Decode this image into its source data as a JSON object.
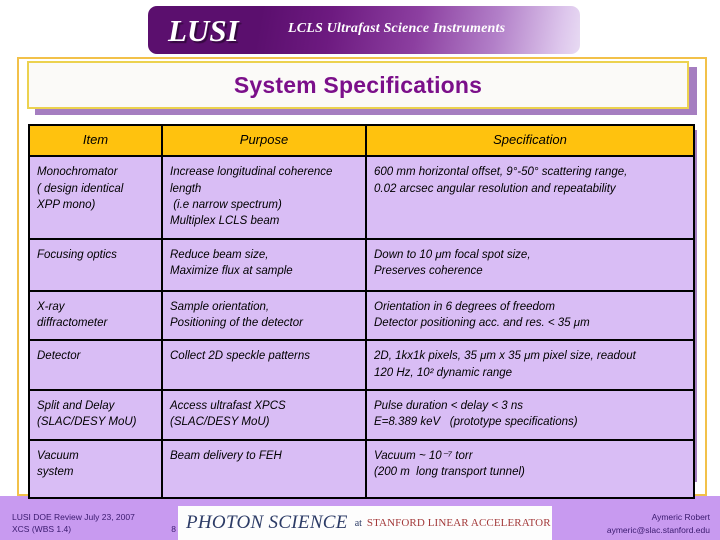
{
  "banner": {
    "logo_text": "LUSI",
    "subtitle": "LCLS Ultrafast Science Instruments"
  },
  "title": "System Specifications",
  "table": {
    "headers": [
      "Item",
      "Purpose",
      "Specification"
    ],
    "rows": [
      {
        "item": "Monochromator\n( design identical\nXPP mono)",
        "purpose": "Increase longitudinal coherence length\n (i.e narrow spectrum)\nMultiplex LCLS beam",
        "specification": "600 mm horizontal offset, 9°-50° scattering range,\n0.02 arcsec angular resolution and repeatability"
      },
      {
        "item": "Focusing optics",
        "purpose": "Reduce beam size,\nMaximize flux at sample",
        "specification": "Down to 10 μm focal spot size,\nPreserves coherence"
      },
      {
        "item": "X-ray\ndiffractometer",
        "purpose": "Sample orientation,\nPositioning of the detector",
        "specification": "Orientation in 6 degrees of freedom\nDetector positioning acc. and res. < 35 μm"
      },
      {
        "item": "Detector",
        "purpose": "Collect 2D speckle patterns",
        "specification": "2D, 1kx1k pixels, 35 μm x 35 μm pixel size, readout\n120 Hz, 10² dynamic range"
      },
      {
        "item": "Split and Delay\n(SLAC/DESY MoU)",
        "purpose": "Access ultrafast XPCS\n(SLAC/DESY MoU)",
        "specification": "Pulse duration < delay < 3 ns\nE=8.389 keV   (prototype specifications)"
      },
      {
        "item": "Vacuum\nsystem",
        "purpose": "Beam delivery to FEH",
        "specification": "Vacuum ~ 10⁻⁷ torr\n(200 m  long transport tunnel)"
      }
    ]
  },
  "footer": {
    "left_line1": "LUSI DOE Review July 23, 2007",
    "left_line2": "XCS (WBS 1.4)",
    "page_number": "8",
    "logo_main": "PHOTON SCIENCE",
    "logo_at": "at",
    "logo_slac": "STANFORD LINEAR ACCELERATOR CENTER",
    "author": "Aymeric Robert",
    "email": "aymeric@slac.stanford.edu"
  },
  "colors": {
    "banner_purple": "#5b0f6e",
    "title_purple": "#7b0f8a",
    "header_gold": "#ffc20e",
    "cell_lavender": "#d9bdf5",
    "frame_gold": "#f2c14a",
    "footer_band": "#c89af0"
  }
}
